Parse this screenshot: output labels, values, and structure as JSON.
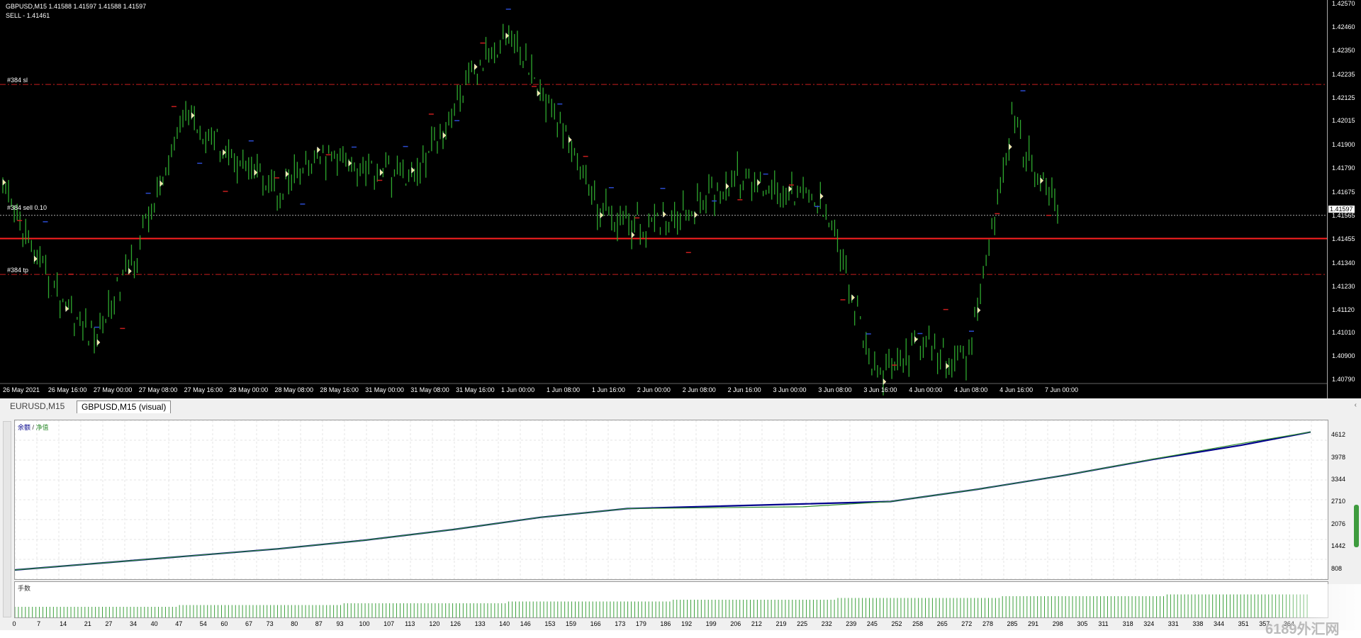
{
  "window": {
    "symbol_info": "GBPUSD,M15  1.41588 1.41597 1.41588 1.41597",
    "signal": "SELL - 1.41461"
  },
  "order_lines": {
    "sl_label": "#384 sl",
    "sell_label": "#384 sell 0.10",
    "tp_label": "#384 tp"
  },
  "price_axis": {
    "ticks": [
      "1.42570",
      "1.42460",
      "1.42350",
      "1.42235",
      "1.42125",
      "1.42015",
      "1.41900",
      "1.41790",
      "1.41675",
      "1.41565",
      "1.41455",
      "1.41340",
      "1.41230",
      "1.41120",
      "1.41010",
      "1.40900",
      "1.40790"
    ],
    "current_price": "1.41597"
  },
  "time_axis": {
    "ticks": [
      "26 May 2021",
      "26 May 16:00",
      "27 May 00:00",
      "27 May 08:00",
      "27 May 16:00",
      "28 May 00:00",
      "28 May 08:00",
      "28 May 16:00",
      "31 May 00:00",
      "31 May 08:00",
      "31 May 16:00",
      "1 Jun 00:00",
      "1 Jun 08:00",
      "1 Jun 16:00",
      "2 Jun 00:00",
      "2 Jun 08:00",
      "2 Jun 16:00",
      "3 Jun 00:00",
      "3 Jun 08:00",
      "3 Jun 16:00",
      "4 Jun 00:00",
      "4 Jun 08:00",
      "4 Jun 16:00",
      "7 Jun 00:00"
    ]
  },
  "tabs": [
    {
      "label": "EURUSD,M15",
      "active": false
    },
    {
      "label": "GBPUSD,M15 (visual)",
      "active": true
    }
  ],
  "report": {
    "legend_balance": "余额",
    "legend_sep": " / ",
    "legend_equity": "净值",
    "volume_label": "手数",
    "y_ticks": [
      "4612",
      "3978",
      "3344",
      "2710",
      "2076",
      "1442",
      "808"
    ],
    "x_ticks": [
      "0",
      "7",
      "14",
      "21",
      "27",
      "34",
      "40",
      "47",
      "54",
      "60",
      "67",
      "73",
      "80",
      "87",
      "93",
      "100",
      "107",
      "113",
      "120",
      "126",
      "133",
      "140",
      "146",
      "153",
      "159",
      "166",
      "173",
      "179",
      "186",
      "192",
      "199",
      "206",
      "212",
      "219",
      "225",
      "232",
      "239",
      "245",
      "252",
      "258",
      "265",
      "272",
      "278",
      "285",
      "291",
      "298",
      "305",
      "311",
      "318",
      "324",
      "331",
      "338",
      "344",
      "351",
      "357",
      "364"
    ],
    "watermark": "6189外汇网"
  },
  "colors": {
    "candle": "#2ea82e",
    "sl_tp_line": "#c81e1e",
    "sell_line": "#ff2020",
    "balance": "#00008b",
    "equity": "#2e8b2e",
    "volume": "#3ca03c"
  },
  "chart_data": [
    {
      "type": "line",
      "title": "GBPUSD,M15",
      "x": [
        "26 May 2021",
        "26 May 16:00",
        "27 May 00:00",
        "27 May 08:00",
        "27 May 16:00",
        "28 May 00:00",
        "28 May 08:00",
        "28 May 16:00",
        "31 May 00:00",
        "31 May 08:00",
        "31 May 16:00",
        "1 Jun 00:00",
        "1 Jun 08:00",
        "1 Jun 16:00",
        "2 Jun 00:00",
        "2 Jun 08:00",
        "2 Jun 16:00",
        "3 Jun 00:00",
        "3 Jun 08:00",
        "3 Jun 16:00",
        "4 Jun 00:00",
        "4 Jun 08:00",
        "4 Jun 16:00",
        "7 Jun 00:00"
      ],
      "series": [
        {
          "values": [
            1.4168,
            1.4125,
            1.4098,
            1.4145,
            1.4205,
            1.4185,
            1.417,
            1.4185,
            1.418,
            1.4175,
            1.4215,
            1.4245,
            1.4205,
            1.416,
            1.415,
            1.416,
            1.4175,
            1.417,
            1.416,
            1.408,
            1.4095,
            1.4085,
            1.42,
            1.416
          ]
        }
      ],
      "ylim": [
        1.4079,
        1.4257
      ]
    },
    {
      "type": "line",
      "series": [
        {
          "name": "余额",
          "values": [
            800,
            1000,
            1200,
            1400,
            1650,
            1950,
            2300,
            2550,
            2680,
            2750,
            3100,
            3500,
            3950,
            4350,
            4730
          ]
        },
        {
          "name": "净值",
          "values": [
            800,
            1000,
            1200,
            1400,
            1650,
            1950,
            2300,
            2550,
            2600,
            2750,
            3100,
            3500,
            3960,
            4400,
            4730
          ]
        }
      ],
      "x": [
        0,
        25,
        50,
        75,
        100,
        125,
        150,
        175,
        225,
        250,
        275,
        300,
        325,
        350,
        370
      ],
      "ylim": [
        700,
        4900
      ]
    }
  ]
}
